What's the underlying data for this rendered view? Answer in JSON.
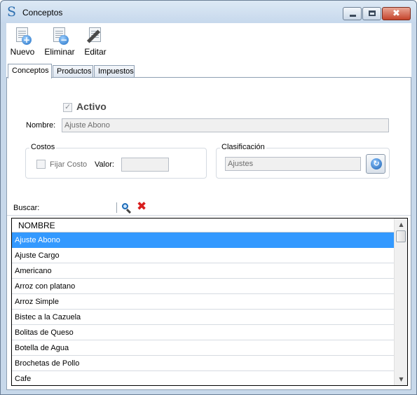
{
  "window": {
    "title": "Conceptos",
    "app_icon": "S",
    "controls": {
      "min_icon": "minimize-icon",
      "max_icon": "maximize-icon",
      "close_icon": "close-icon",
      "close_glyph": "✖"
    }
  },
  "toolbar": {
    "new_label": "Nuevo",
    "delete_label": "Eliminar",
    "edit_label": "Editar",
    "new_badge": "+",
    "delete_badge": "−"
  },
  "tabs": [
    {
      "label": "Conceptos",
      "active": true
    },
    {
      "label": "Productos",
      "active": false
    },
    {
      "label": "Impuestos",
      "active": false
    }
  ],
  "form": {
    "active_label": "Activo",
    "active_checked": true,
    "name_label": "Nombre:",
    "name_value": "Ajuste Abono",
    "costs_group": {
      "title": "Costos",
      "fix_cost_label": "Fijar Costo",
      "fix_cost_checked": false,
      "value_label": "Valor:",
      "value_value": ""
    },
    "classification_group": {
      "title": "Clasificación",
      "value": "Ajustes",
      "refresh_icon": "refresh-icon",
      "refresh_glyph": "↻"
    }
  },
  "search": {
    "label": "Buscar:",
    "value": "",
    "search_icon": "search-icon",
    "clear_icon": "clear-icon",
    "clear_glyph": "✖"
  },
  "grid": {
    "column": "NOMBRE",
    "selected_index": 0,
    "rows": [
      "Ajuste Abono",
      "Ajuste Cargo",
      "Americano",
      "Arroz con platano",
      "Arroz Simple",
      "Bistec a la Cazuela",
      "Bolitas de Queso",
      "Botella de Agua",
      "Brochetas de Pollo",
      "Cafe"
    ],
    "scroll_up": "▲",
    "scroll_down": "▼"
  },
  "colors": {
    "selection": "#3399ff",
    "window_frame": "#c7d8ea",
    "clear_red": "#d81e1e"
  }
}
